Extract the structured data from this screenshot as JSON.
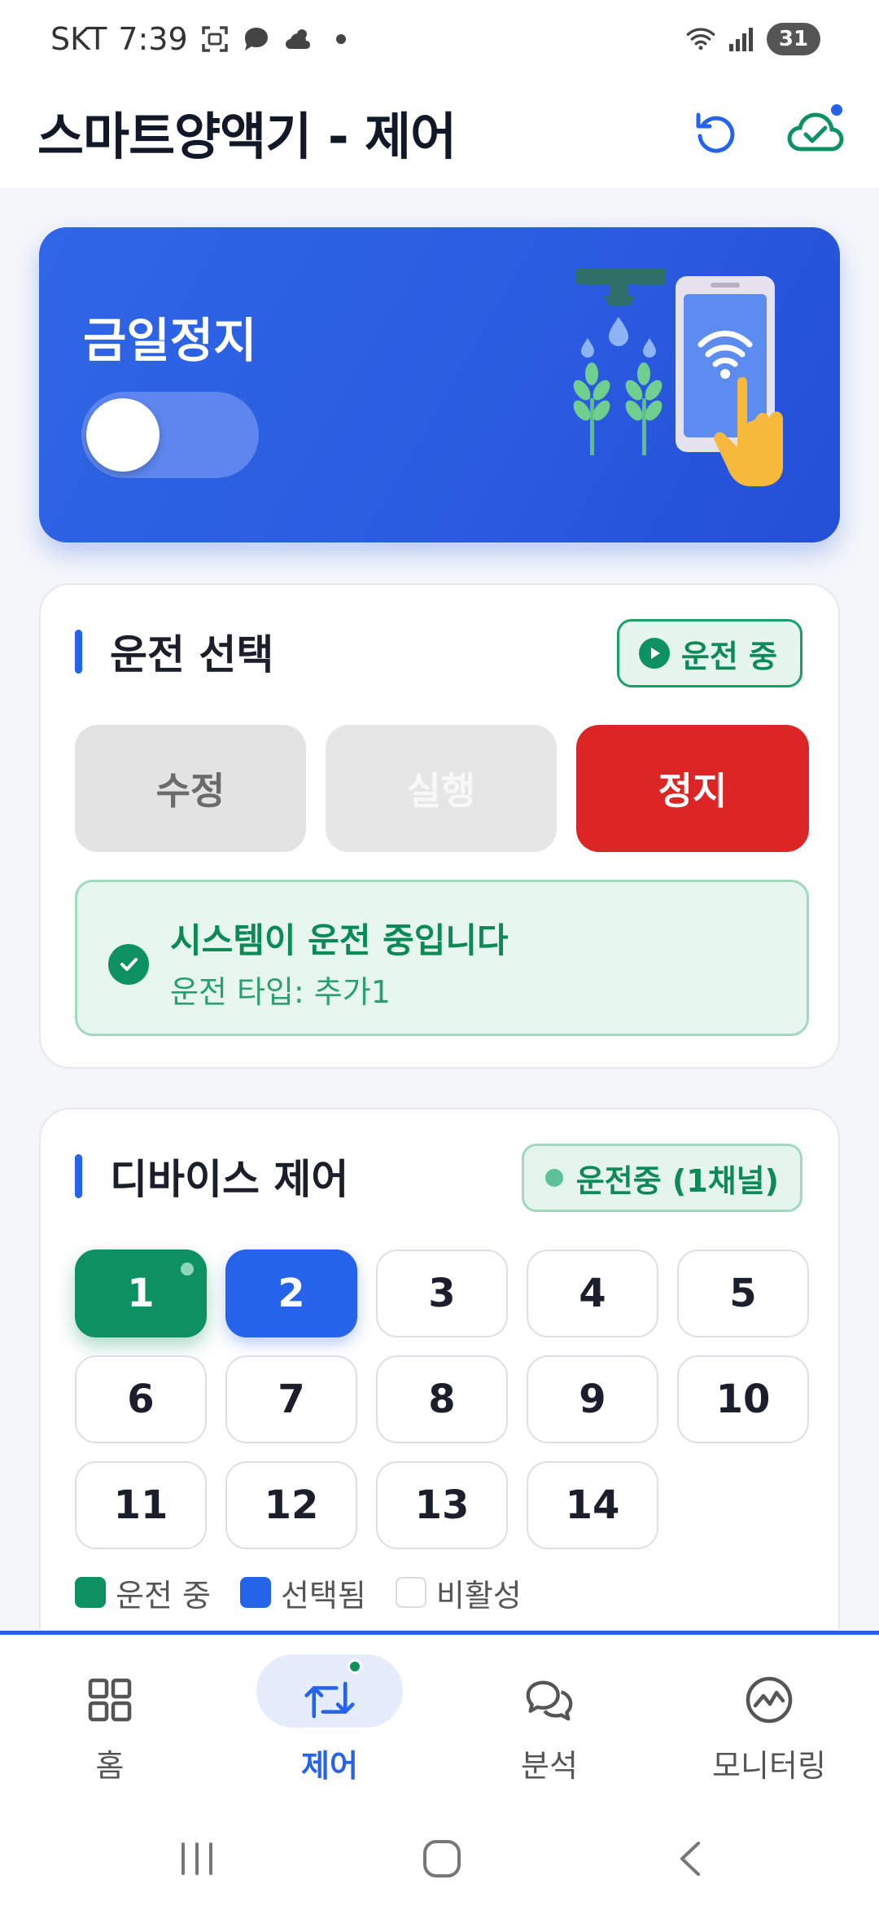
{
  "status_bar": {
    "carrier": "SKT",
    "time": "7:39",
    "battery": "31"
  },
  "header": {
    "title": "스마트양액기 - 제어",
    "icons": [
      "refresh-icon",
      "cloud-check-icon"
    ]
  },
  "hero": {
    "title": "금일정지",
    "toggle_on": false
  },
  "operation": {
    "title": "운전 선택",
    "badge": "운전 중",
    "buttons": {
      "edit": "수정",
      "run": "실행",
      "stop": "정지"
    },
    "status_main": "시스템이 운전 중입니다",
    "status_sub": "운전 타입: 추가1"
  },
  "device": {
    "title": "디바이스 제어",
    "badge": "운전중 (1채널)",
    "channels": [
      {
        "label": "1",
        "state": "running"
      },
      {
        "label": "2",
        "state": "selected"
      },
      {
        "label": "3",
        "state": "inactive"
      },
      {
        "label": "4",
        "state": "inactive"
      },
      {
        "label": "5",
        "state": "inactive"
      },
      {
        "label": "6",
        "state": "inactive"
      },
      {
        "label": "7",
        "state": "inactive"
      },
      {
        "label": "8",
        "state": "inactive"
      },
      {
        "label": "9",
        "state": "inactive"
      },
      {
        "label": "10",
        "state": "inactive"
      },
      {
        "label": "11",
        "state": "inactive"
      },
      {
        "label": "12",
        "state": "inactive"
      },
      {
        "label": "13",
        "state": "inactive"
      },
      {
        "label": "14",
        "state": "inactive"
      }
    ],
    "legend": {
      "running": "운전 중",
      "selected": "선택됨",
      "inactive": "비활성"
    }
  },
  "nav": {
    "items": [
      {
        "label": "홈",
        "icon": "grid-icon"
      },
      {
        "label": "제어",
        "icon": "swap-icon",
        "active": true
      },
      {
        "label": "분석",
        "icon": "chat-icon"
      },
      {
        "label": "모니터링",
        "icon": "monitor-chart-icon"
      }
    ]
  },
  "colors": {
    "primary": "#2563eb",
    "running": "#0e9160",
    "stop": "#dc2626"
  }
}
